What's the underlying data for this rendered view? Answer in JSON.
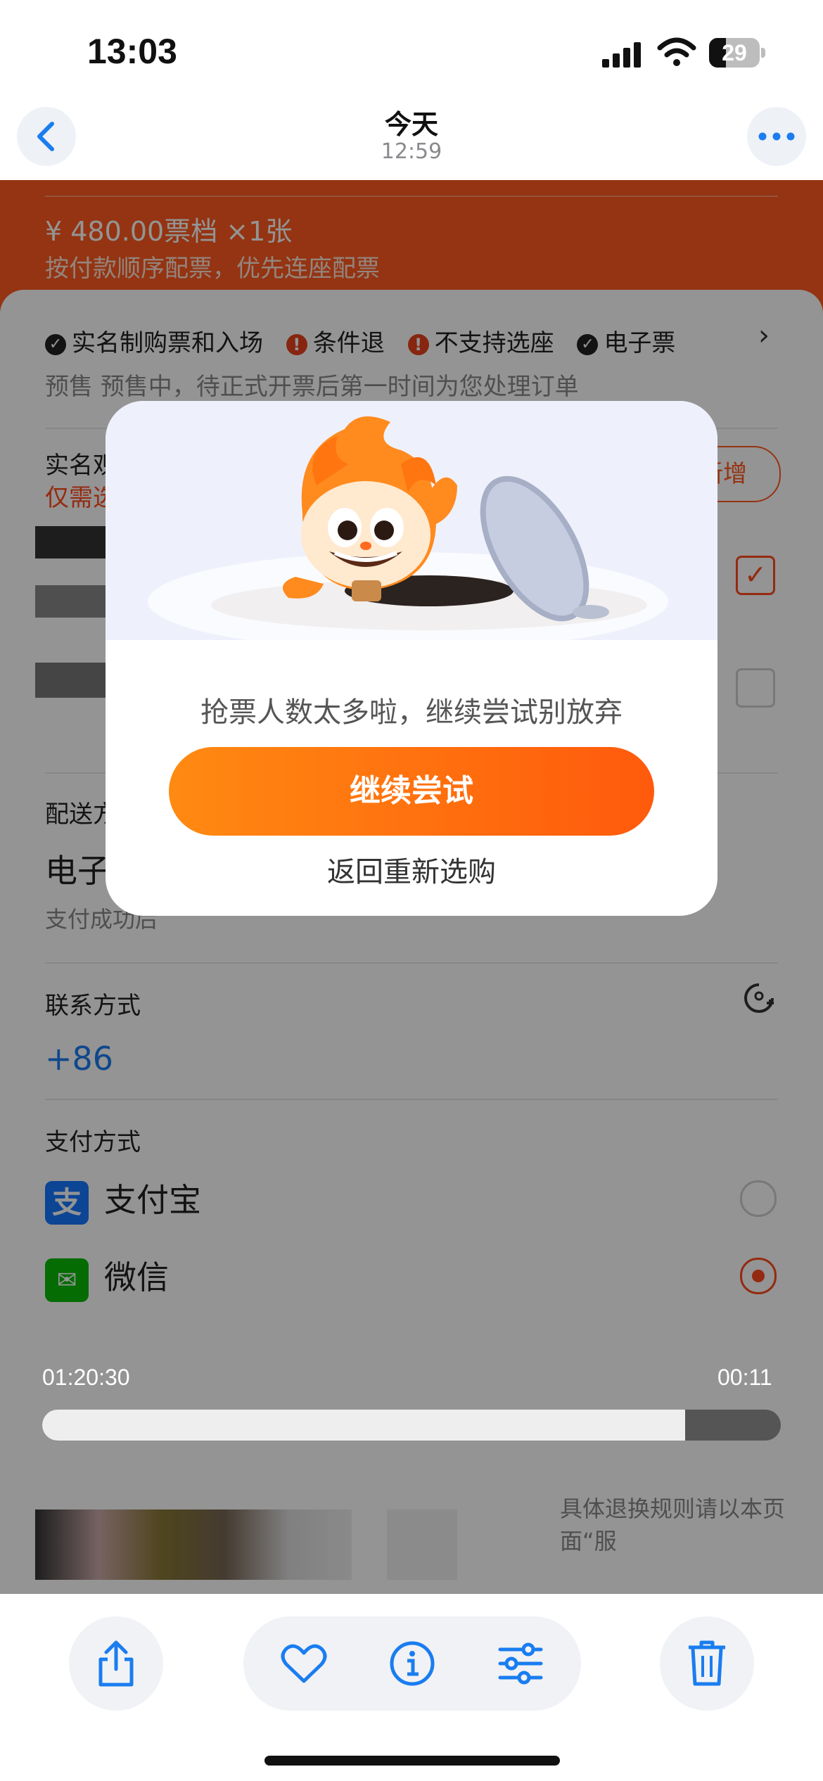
{
  "status_bar": {
    "time": "13:03",
    "battery": "29"
  },
  "nav": {
    "title": "今天",
    "subtitle": "12:59"
  },
  "photo": {
    "price_line": "¥ 480.00票档  ×1张",
    "price_note": "按付款顺序配票，优先连座配票",
    "tags": [
      "实名制购票和入场",
      "条件退",
      "不支持选座",
      "电子票"
    ],
    "presale": "预售  预售中，待正式开票后第一时间为您处理订单",
    "attendee_label": "实名观演人",
    "attendee_note": "仅需选择1位；入场需携带对应证件",
    "add_button": "新增",
    "delivery_label": "配送方式",
    "delivery_value": "电子票",
    "delivery_note": "支付成功后",
    "contact_label": "联系方式",
    "contact_value": "+86",
    "payment_label": "支付方式",
    "payment_alipay": "支付宝",
    "payment_wechat": "微信",
    "rules_text": "具体退换规则请以本页面“服"
  },
  "video": {
    "elapsed": "01:20:30",
    "remaining": "00:11",
    "progress": 0.87
  },
  "dialog": {
    "message": "抢票人数太多啦，继续尝试别放弃",
    "primary": "继续尝试",
    "secondary": "返回重新选购"
  },
  "toolbar": {
    "icons": [
      "share-icon",
      "heart-icon",
      "info-icon",
      "adjust-icon",
      "trash-icon"
    ]
  },
  "colors": {
    "accent": "#ff5a1f",
    "ios_blue": "#1a7df0",
    "button_start": "#ff8a12",
    "button_end": "#ff5a0c"
  }
}
